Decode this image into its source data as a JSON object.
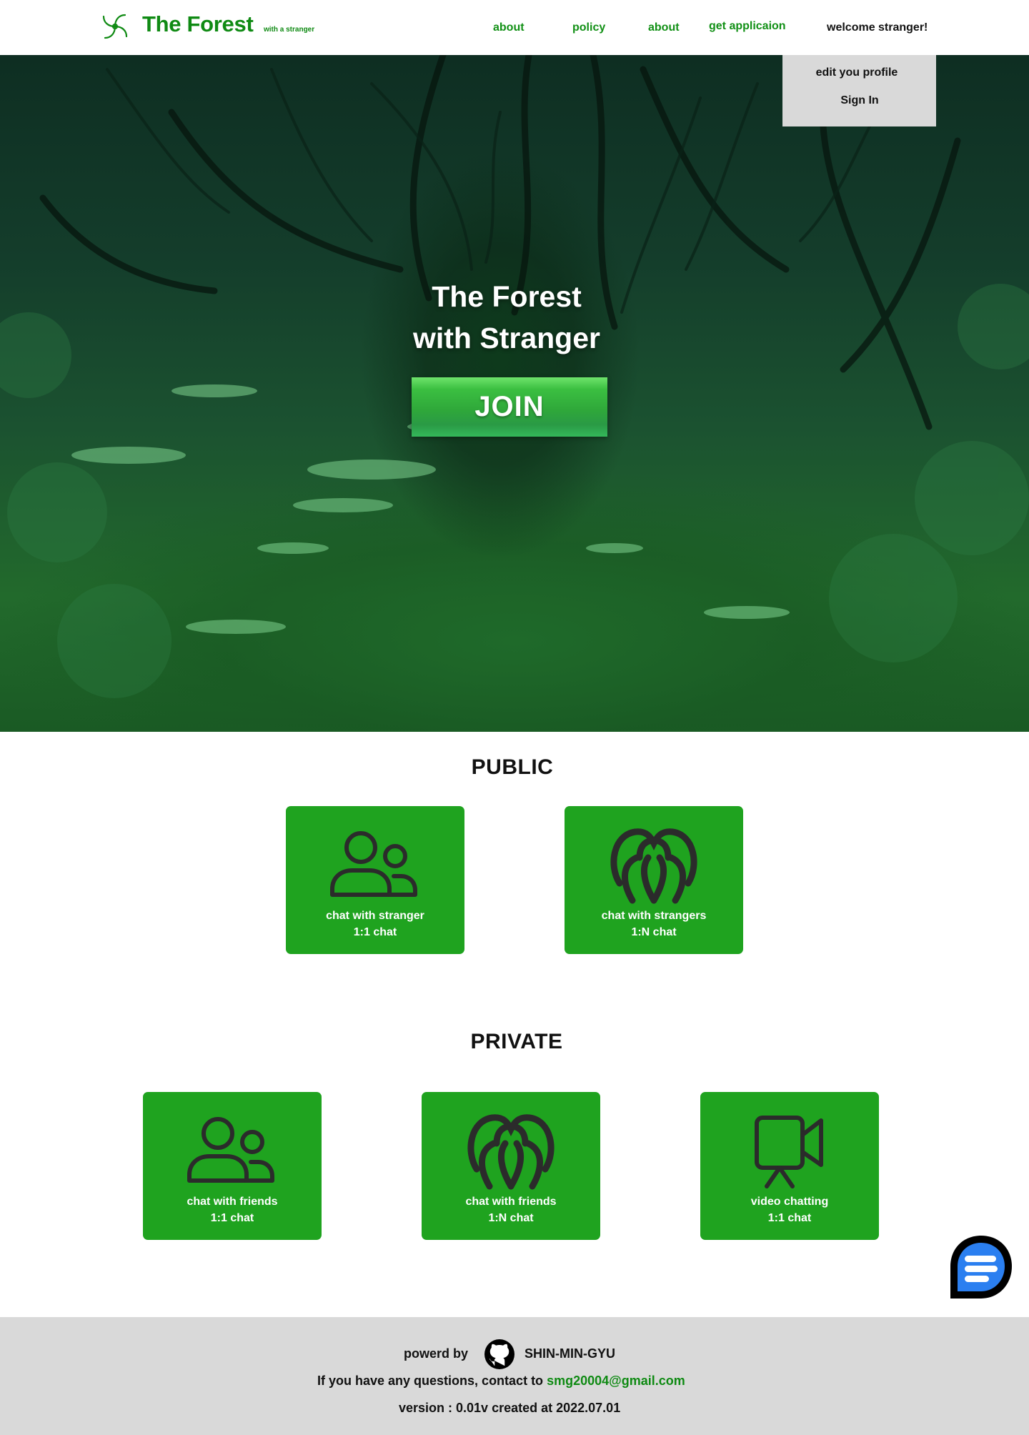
{
  "header": {
    "title": "The Forest",
    "subtitle": "with a stranger",
    "nav": [
      {
        "label": "about"
      },
      {
        "label": "policy"
      },
      {
        "label": "about"
      },
      {
        "label": "get applicaion"
      }
    ],
    "welcome": "welcome stranger!",
    "brand_color": "#0f8a13"
  },
  "dropdown": {
    "items": [
      {
        "label": "edit  you profile"
      },
      {
        "label": "Sign In"
      }
    ]
  },
  "hero": {
    "title_line1": "The Forest",
    "title_line2": "with Stranger",
    "join_label": "JOIN"
  },
  "public": {
    "title": "PUBLIC",
    "cards": [
      {
        "line1": "chat with stranger",
        "line2": "1:1 chat",
        "icon": "users-pair-icon"
      },
      {
        "line1": "chat with strangers",
        "line2": "1:N chat",
        "icon": "users-group-icon"
      }
    ]
  },
  "private": {
    "title": "PRIVATE",
    "cards": [
      {
        "line1": "chat with friends",
        "line2": "1:1 chat",
        "icon": "users-pair-icon"
      },
      {
        "line1": "chat with friends",
        "line2": "1:N chat",
        "icon": "users-group-icon"
      },
      {
        "line1": "video chatting",
        "line2": "1:1 chat",
        "icon": "video-camera-icon"
      }
    ]
  },
  "card_color": "#1fa31f",
  "footer": {
    "powered_label": "powerd by",
    "author": "SHIN-MIN-GYU",
    "contact_prefix": "If you have any questions,  contact to",
    "email": "smg20004@gmail.com",
    "version": "version : 0.01v created at 2022.07.01"
  }
}
